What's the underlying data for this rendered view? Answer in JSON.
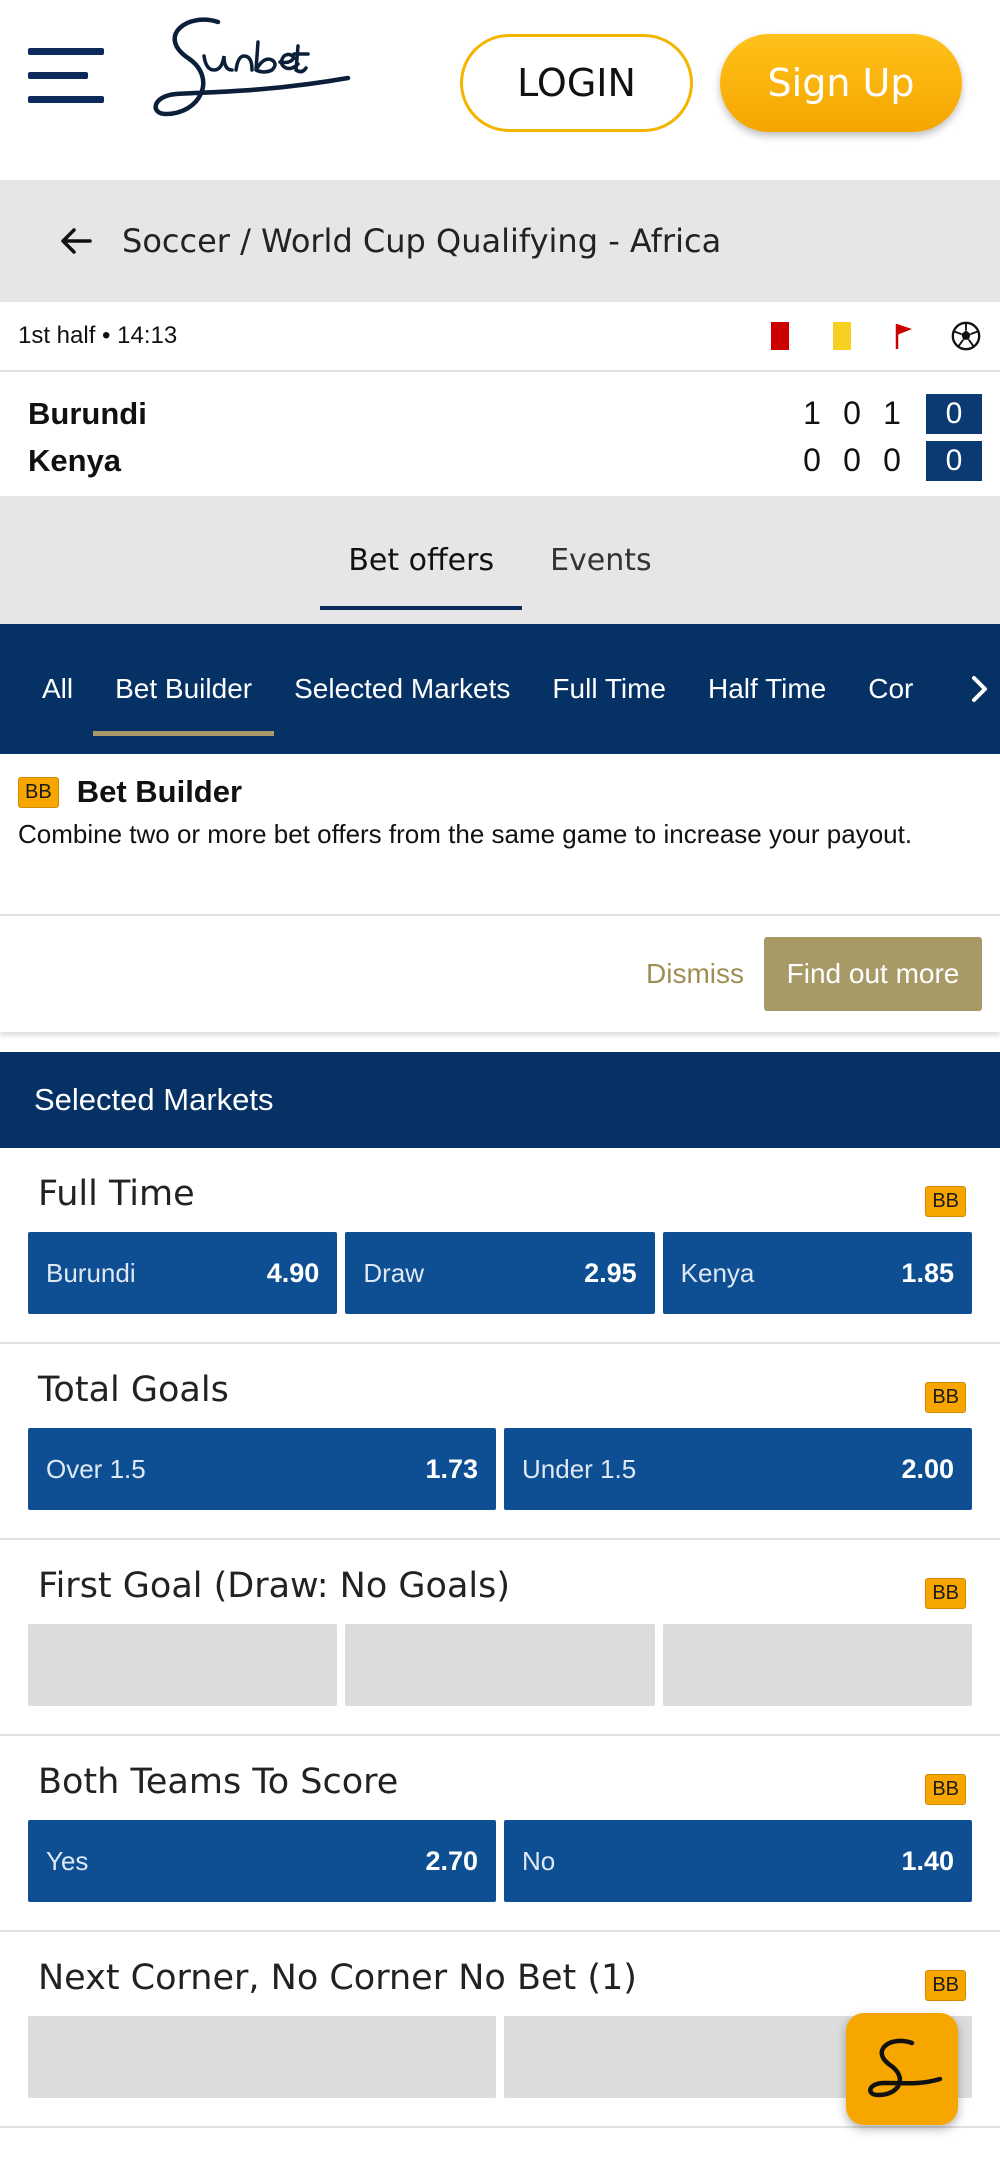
{
  "header": {
    "logo_text": "Sunbet",
    "login_label": "LOGIN",
    "signup_label": "Sign Up"
  },
  "breadcrumb": {
    "path": "Soccer / World Cup Qualifying - Africa"
  },
  "live": {
    "status": "1st half • 14:13"
  },
  "scoreboard": {
    "home": {
      "name": "Burundi",
      "stats": [
        "1",
        "0",
        "1"
      ],
      "score": "0"
    },
    "away": {
      "name": "Kenya",
      "stats": [
        "0",
        "0",
        "0"
      ],
      "score": "0"
    }
  },
  "bet_tabs": [
    {
      "label": "Bet offers",
      "active": true
    },
    {
      "label": "Events",
      "active": false
    }
  ],
  "market_nav": [
    {
      "label": "All",
      "active": false
    },
    {
      "label": "Bet Builder",
      "active": true
    },
    {
      "label": "Selected Markets",
      "active": false
    },
    {
      "label": "Full Time",
      "active": false
    },
    {
      "label": "Half Time",
      "active": false
    },
    {
      "label": "Cor",
      "active": false
    }
  ],
  "bet_builder": {
    "badge": "BB",
    "title": "Bet Builder",
    "description": "Combine two or more bet offers from the same game to increase your payout.",
    "dismiss_label": "Dismiss",
    "find_out_label": "Find out more"
  },
  "selected_markets": {
    "title": "Selected Markets",
    "markets": [
      {
        "title": "Full Time",
        "badge": "BB",
        "odds": [
          {
            "label": "Burundi",
            "price": "4.90"
          },
          {
            "label": "Draw",
            "price": "2.95"
          },
          {
            "label": "Kenya",
            "price": "1.85"
          }
        ]
      },
      {
        "title": "Total Goals",
        "badge": "BB",
        "odds": [
          {
            "label": "Over  1.5",
            "price": "1.73"
          },
          {
            "label": "Under  1.5",
            "price": "2.00"
          }
        ]
      },
      {
        "title": "First Goal (Draw: No Goals)",
        "badge": "BB",
        "empty_slots": 3
      },
      {
        "title": "Both Teams To Score",
        "badge": "BB",
        "odds": [
          {
            "label": "Yes",
            "price": "2.70"
          },
          {
            "label": "No",
            "price": "1.40"
          }
        ]
      },
      {
        "title": "Next Corner, No Corner No Bet (1)",
        "badge": "BB",
        "empty_slots": 2
      }
    ]
  },
  "colors": {
    "navy": "#053164",
    "odds_blue": "#0e4f93",
    "accent_yellow": "#f7a600",
    "gold": "#a89a66"
  }
}
